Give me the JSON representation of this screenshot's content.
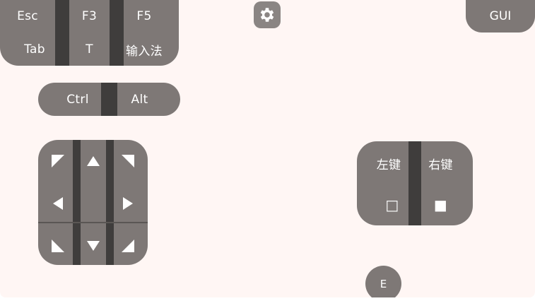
{
  "function_keys": {
    "esc": "Esc",
    "f3": "F3",
    "f5": "F5",
    "tab": "Tab",
    "t": "T",
    "ime": "输入法"
  },
  "modifier_keys": {
    "ctrl": "Ctrl",
    "alt": "Alt"
  },
  "gui_button": "GUI",
  "e_button": "E",
  "mouse": {
    "left_label": "左键",
    "right_label": "右键",
    "left_glyph": "□",
    "right_glyph": "■"
  },
  "dpad_icons": [
    "arrow-up-left-icon",
    "arrow-up-icon",
    "arrow-up-right-icon",
    "arrow-left-icon",
    "arrow-right-icon",
    "arrow-down-left-icon",
    "arrow-down-icon",
    "arrow-down-right-icon"
  ],
  "colors": {
    "background": "#fff6f4",
    "key_fill": "#7e7876",
    "divider": "#3f3d3c",
    "text": "#ffffff"
  }
}
